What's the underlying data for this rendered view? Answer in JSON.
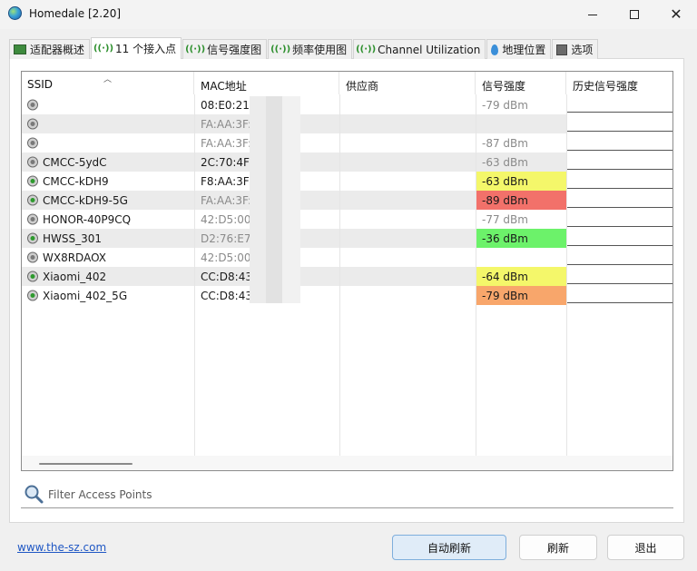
{
  "window": {
    "title": "Homedale [2.20]"
  },
  "tabs": [
    {
      "label": "适配器概述",
      "icon": "adapter-icon",
      "active": false
    },
    {
      "label": "11 个接入点",
      "icon": "signal-icon",
      "active": true
    },
    {
      "label": "信号强度图",
      "icon": "signal-icon",
      "active": false
    },
    {
      "label": "频率使用图",
      "icon": "signal-icon",
      "active": false
    },
    {
      "label": "Channel Utilization",
      "icon": "signal-icon",
      "active": false
    },
    {
      "label": "地理位置",
      "icon": "map-pin-icon",
      "active": false
    },
    {
      "label": "选项",
      "icon": "options-icon",
      "active": false
    }
  ],
  "table": {
    "columns": [
      "SSID",
      "MAC地址",
      "供应商",
      "信号强度",
      "历史信号强度"
    ],
    "rows": [
      {
        "ssid": "",
        "mac": "08:E0:21:",
        "mac_muted": false,
        "signal": "-79 dBm",
        "signal_level": "muted",
        "connected": false
      },
      {
        "ssid": "",
        "mac": "FA:AA:3F:",
        "mac_muted": true,
        "signal": "",
        "signal_level": "none",
        "connected": false
      },
      {
        "ssid": "",
        "mac": "FA:AA:3F:",
        "mac_muted": true,
        "signal": "-87 dBm",
        "signal_level": "muted",
        "connected": false
      },
      {
        "ssid": "CMCC-5ydC",
        "mac": "2C:70:4F:",
        "mac_muted": false,
        "signal": "-63 dBm",
        "signal_level": "muted",
        "connected": false
      },
      {
        "ssid": "CMCC-kDH9",
        "mac": "F8:AA:3F:",
        "mac_muted": false,
        "signal": "-63 dBm",
        "signal_level": "yellow",
        "connected": true
      },
      {
        "ssid": "CMCC-kDH9-5G",
        "mac": "FA:AA:3F:",
        "mac_muted": true,
        "signal": "-89 dBm",
        "signal_level": "red",
        "connected": true
      },
      {
        "ssid": "HONOR-40P9CQ",
        "mac": "42:D5:00:",
        "mac_muted": true,
        "signal": "-77 dBm",
        "signal_level": "muted",
        "connected": false
      },
      {
        "ssid": "HWSS_301",
        "mac": "D2:76:E7:",
        "mac_muted": true,
        "signal": "-36 dBm",
        "signal_level": "green",
        "connected": true
      },
      {
        "ssid": "WX8RDAOX",
        "mac": "42:D5:00:",
        "mac_muted": true,
        "signal": "",
        "signal_level": "none",
        "connected": false
      },
      {
        "ssid": "Xiaomi_402",
        "mac": "CC:D8:43",
        "mac_muted": false,
        "signal": "-64 dBm",
        "signal_level": "yellow",
        "connected": true
      },
      {
        "ssid": "Xiaomi_402_5G",
        "mac": "CC:D8:43",
        "mac_muted": false,
        "signal": "-79 dBm",
        "signal_level": "orange",
        "connected": true
      }
    ]
  },
  "filter": {
    "placeholder": "Filter Access Points",
    "value": ""
  },
  "footer": {
    "link": "www.the-sz.com",
    "auto_refresh": "自动刷新",
    "refresh": "刷新",
    "exit": "退出"
  }
}
